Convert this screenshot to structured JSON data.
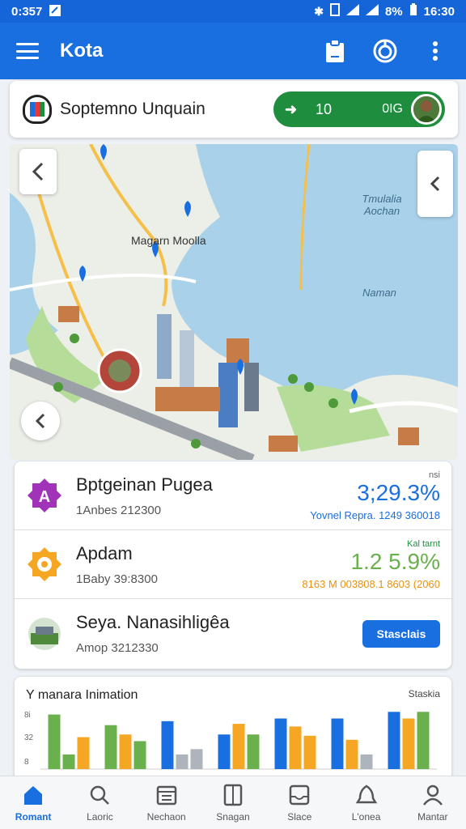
{
  "status_bar": {
    "time": "0:357",
    "battery": "8%",
    "clock": "16:30"
  },
  "app_bar": {
    "title": "Kota"
  },
  "profile": {
    "name": "Soptemno Unquain",
    "score": "10",
    "unit": "0IG"
  },
  "map": {
    "labels": [
      "Magarn Moolla",
      "Tmulalia Aochan",
      "Naman"
    ]
  },
  "list": [
    {
      "title": "Bptgeinan Pugea",
      "subtitle": "1Anbes 212300",
      "corner": "nsi",
      "value": "3;29.3%",
      "detail": "Yovnel Repra. 1249 360018",
      "color": "#1a6fe0",
      "icon": "a-badge-icon"
    },
    {
      "title": "Apdam",
      "subtitle": "1Baby 39:8300",
      "corner": "Kal tarnt",
      "value": "1.2 5.9%",
      "detail": "8163 M 003808.1 8603 (2060",
      "color": "#e8920f",
      "icon": "fire-badge-icon"
    },
    {
      "title": "Seya. Nanasihligêa",
      "subtitle": "Amop 3212330",
      "action": "Stasclais",
      "icon": "thumbnail-image"
    }
  ],
  "chart": {
    "title": "Y manara Inimation",
    "tag": "Staskia",
    "y_ticks": [
      "8i",
      "32",
      "8"
    ]
  },
  "chart_data": {
    "type": "bar",
    "title": "Y manara Inimation",
    "y_tick_labels": [
      "8i",
      "32",
      "8"
    ],
    "ylim": [
      0,
      90
    ],
    "groups": [
      {
        "bars": [
          {
            "value": 82,
            "color": "#6ab04c"
          },
          {
            "value": 22,
            "color": "#6ab04c"
          },
          {
            "value": 48,
            "color": "#f5a623"
          }
        ]
      },
      {
        "bars": [
          {
            "value": 66,
            "color": "#6ab04c"
          },
          {
            "value": 52,
            "color": "#f5a623"
          },
          {
            "value": 42,
            "color": "#6ab04c"
          }
        ]
      },
      {
        "bars": [
          {
            "value": 72,
            "color": "#1a6fe0"
          },
          {
            "value": 22,
            "color": "#aeb4bb"
          },
          {
            "value": 30,
            "color": "#aeb4bb"
          }
        ]
      },
      {
        "bars": [
          {
            "value": 52,
            "color": "#1a6fe0"
          },
          {
            "value": 68,
            "color": "#f5a623"
          },
          {
            "value": 52,
            "color": "#6ab04c"
          }
        ]
      },
      {
        "bars": [
          {
            "value": 76,
            "color": "#1a6fe0"
          },
          {
            "value": 64,
            "color": "#f5a623"
          },
          {
            "value": 50,
            "color": "#f5a623"
          }
        ]
      },
      {
        "bars": [
          {
            "value": 76,
            "color": "#1a6fe0"
          },
          {
            "value": 44,
            "color": "#f5a623"
          },
          {
            "value": 22,
            "color": "#aeb4bb"
          }
        ]
      },
      {
        "bars": [
          {
            "value": 86,
            "color": "#1a6fe0"
          },
          {
            "value": 76,
            "color": "#f5a623"
          },
          {
            "value": 86,
            "color": "#6ab04c"
          }
        ]
      }
    ]
  },
  "bottom_nav": [
    {
      "label": "Romant",
      "icon": "home-icon",
      "active": true
    },
    {
      "label": "Laoric",
      "icon": "search-icon",
      "active": false
    },
    {
      "label": "Nechaon",
      "icon": "calendar-icon",
      "active": false
    },
    {
      "label": "Snagan",
      "icon": "document-icon",
      "active": false
    },
    {
      "label": "Slace",
      "icon": "inbox-icon",
      "active": false
    },
    {
      "label": "L'onea",
      "icon": "bell-icon",
      "active": false
    },
    {
      "label": "Mantar",
      "icon": "person-icon",
      "active": false
    }
  ],
  "colors": {
    "primary": "#1a6fe0",
    "green": "#1e8e3e",
    "orange": "#e8920f",
    "purple": "#a033b8"
  }
}
